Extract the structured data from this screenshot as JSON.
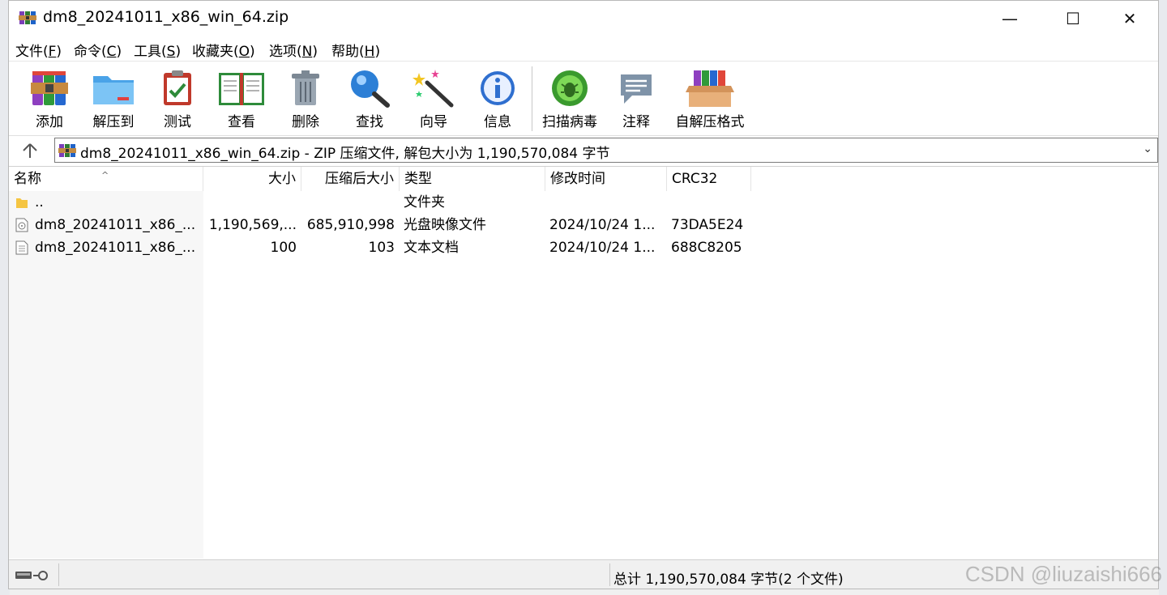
{
  "window": {
    "title": "dm8_20241011_x86_win_64.zip",
    "minimize": "—",
    "maximize": "☐",
    "close": "✕"
  },
  "menu": [
    {
      "label": "文件(",
      "key": "F",
      "suffix": ")"
    },
    {
      "label": "命令(",
      "key": "C",
      "suffix": ")"
    },
    {
      "label": "工具(",
      "key": "S",
      "suffix": ")"
    },
    {
      "label": "收藏夹(",
      "key": "O",
      "suffix": ")"
    },
    {
      "label": "选项(",
      "key": "N",
      "suffix": ")"
    },
    {
      "label": "帮助(",
      "key": "H",
      "suffix": ")"
    }
  ],
  "toolbar": {
    "add": "添加",
    "extract": "解压到",
    "test": "测试",
    "view": "查看",
    "delete": "删除",
    "find": "查找",
    "wizard": "向导",
    "info": "信息",
    "scan": "扫描病毒",
    "comment": "注释",
    "sfx": "自解压格式"
  },
  "address": {
    "text": "dm8_20241011_x86_win_64.zip - ZIP 压缩文件, 解包大小为 1,190,570,084 字节"
  },
  "columns": {
    "name": "名称",
    "size": "大小",
    "packed": "压缩后大小",
    "type": "类型",
    "modified": "修改时间",
    "crc": "CRC32"
  },
  "rows": [
    {
      "name": "..",
      "size": "",
      "packed": "",
      "type": "文件夹",
      "modified": "",
      "crc": ""
    },
    {
      "name": "dm8_20241011_x86_...",
      "size": "1,190,569,...",
      "packed": "685,910,998",
      "type": "光盘映像文件",
      "modified": "2024/10/24 1...",
      "crc": "73DA5E24"
    },
    {
      "name": "dm8_20241011_x86_...",
      "size": "100",
      "packed": "103",
      "type": "文本文档",
      "modified": "2024/10/24 1...",
      "crc": "688C8205"
    }
  ],
  "status": {
    "summary": "总计 1,190,570,084 字节(2 个文件)"
  },
  "watermark": "CSDN @liuzaishi666",
  "colors": {
    "accent": "#0078d7",
    "folder": "#f5c542"
  }
}
